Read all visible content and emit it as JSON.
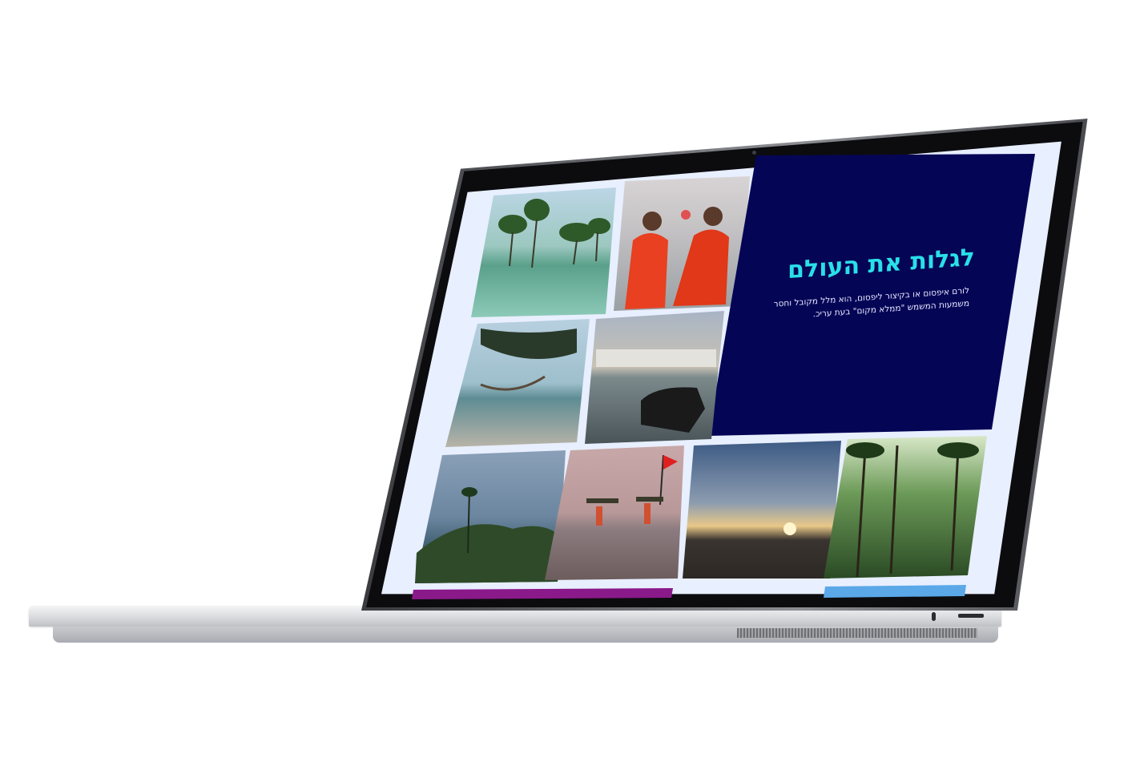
{
  "hero": {
    "title": "לגלות את העולם",
    "body": "לורם איפסום או בקיצור ליפסום, הוא מלל מקובל וחסר משמעות המשמש \"ממלא מקום\" בעת עריכ."
  },
  "colors": {
    "hero_background": "#050556",
    "hero_title": "#29e0e8",
    "page_background": "#e8efff",
    "strip_purple": "#8a1a8a",
    "strip_blue": "#5aa8e8"
  },
  "gallery": [
    {
      "name": "mangrove-trees-photo"
    },
    {
      "name": "monks-in-red-robes-photo"
    },
    {
      "name": "beach-hammock-photo"
    },
    {
      "name": "river-cow-photo"
    },
    {
      "name": "misty-hills-photo"
    },
    {
      "name": "beach-carriers-flag-photo"
    },
    {
      "name": "sunset-shore-photo"
    },
    {
      "name": "palm-forest-photo"
    }
  ]
}
